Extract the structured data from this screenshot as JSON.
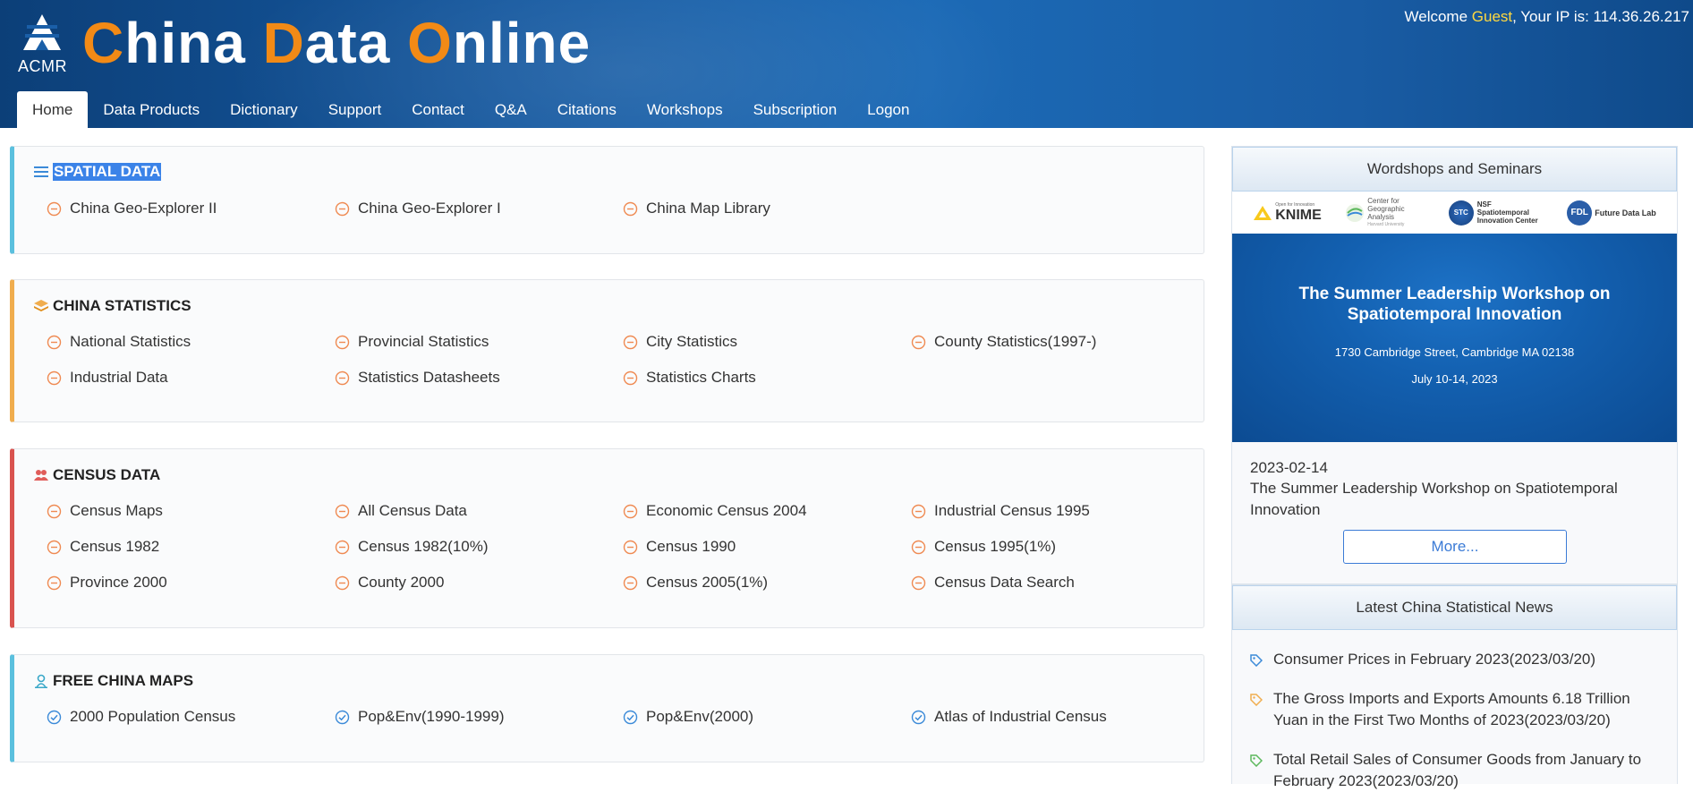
{
  "header": {
    "logo_text": "ACMR",
    "title_parts": [
      {
        "cap": "C",
        "rest": "hina "
      },
      {
        "cap": "D",
        "rest": "ata "
      },
      {
        "cap": "O",
        "rest": "nline"
      }
    ],
    "welcome_prefix": "Welcome ",
    "welcome_user": "Guest",
    "welcome_suffix": ", Your IP is: 114.36.26.217",
    "colors": {
      "accent_orange": "#f28a16",
      "guest_yellow": "#ffd940",
      "header_blue": "#15589f"
    }
  },
  "nav": {
    "tabs": [
      "Home",
      "Data Products",
      "Dictionary",
      "Support",
      "Contact",
      "Q&A",
      "Citations",
      "Workshops",
      "Subscription",
      "Logon"
    ],
    "active": "Home"
  },
  "sections": {
    "spatial": {
      "title": "SPATIAL DATA",
      "icon": "list-icon",
      "accent": "#5bc0de",
      "items": [
        "China Geo-Explorer II",
        "China Geo-Explorer I",
        "China Map Library"
      ]
    },
    "statistics": {
      "title": "CHINA STATISTICS",
      "icon": "layers-icon",
      "accent": "#f0ad4e",
      "items": [
        "National Statistics",
        "Provincial Statistics",
        "City Statistics",
        "County Statistics(1997-)",
        "Industrial Data",
        "Statistics Datasheets",
        "Statistics Charts"
      ]
    },
    "census": {
      "title": "CENSUS DATA",
      "icon": "users-icon",
      "accent": "#d9534f",
      "items": [
        "Census Maps",
        "All Census Data",
        "Economic Census 2004",
        "Industrial Census 1995",
        "Census 1982",
        "Census 1982(10%)",
        "Census 1990",
        "Census 1995(1%)",
        "Province 2000",
        "County 2000",
        "Census 2005(1%)",
        "Census Data Search"
      ]
    },
    "maps": {
      "title": "FREE CHINA MAPS",
      "icon": "user-pin-icon",
      "accent": "#5bc0de",
      "items": [
        "2000 Population Census",
        "Pop&Env(1990-1999)",
        "Pop&Env(2000)",
        "Atlas of Industrial Census"
      ]
    }
  },
  "workshops": {
    "heading": "Wordshops and Seminars",
    "banner": {
      "logos": {
        "knime_tagline": "Open for Innovation",
        "knime": "KNIME",
        "cga": "Center for Geographic Analysis",
        "cga_sub": "Harvard University",
        "nsf": "NSF Spatiotemporal Innovation Center",
        "nsf_mark": "STC",
        "fdl": "Future Data Lab",
        "fdl_mark": "FDL"
      },
      "title_line1": "The Summer Leadership Workshop on",
      "title_line2": "Spatiotemporal Innovation",
      "address": "1730 Cambridge Street, Cambridge MA 02138",
      "dates": "July 10-14, 2023"
    },
    "date": "2023-02-14",
    "title": "The Summer Leadership Workshop on Spatiotemporal Innovation",
    "more": "More..."
  },
  "news": {
    "heading": "Latest China Statistical News",
    "items": [
      {
        "text": "Consumer Prices in February 2023(2023/03/20)",
        "tag_color": "#3b8ad8"
      },
      {
        "text": "The Gross Imports and Exports Amounts 6.18 Trillion Yuan in the First Two Months of 2023(2023/03/20)",
        "tag_color": "#f0ad4e"
      },
      {
        "text": "Total Retail Sales of Consumer Goods from January to February 2023(2023/03/20)",
        "tag_color": "#5cb85c"
      }
    ]
  }
}
